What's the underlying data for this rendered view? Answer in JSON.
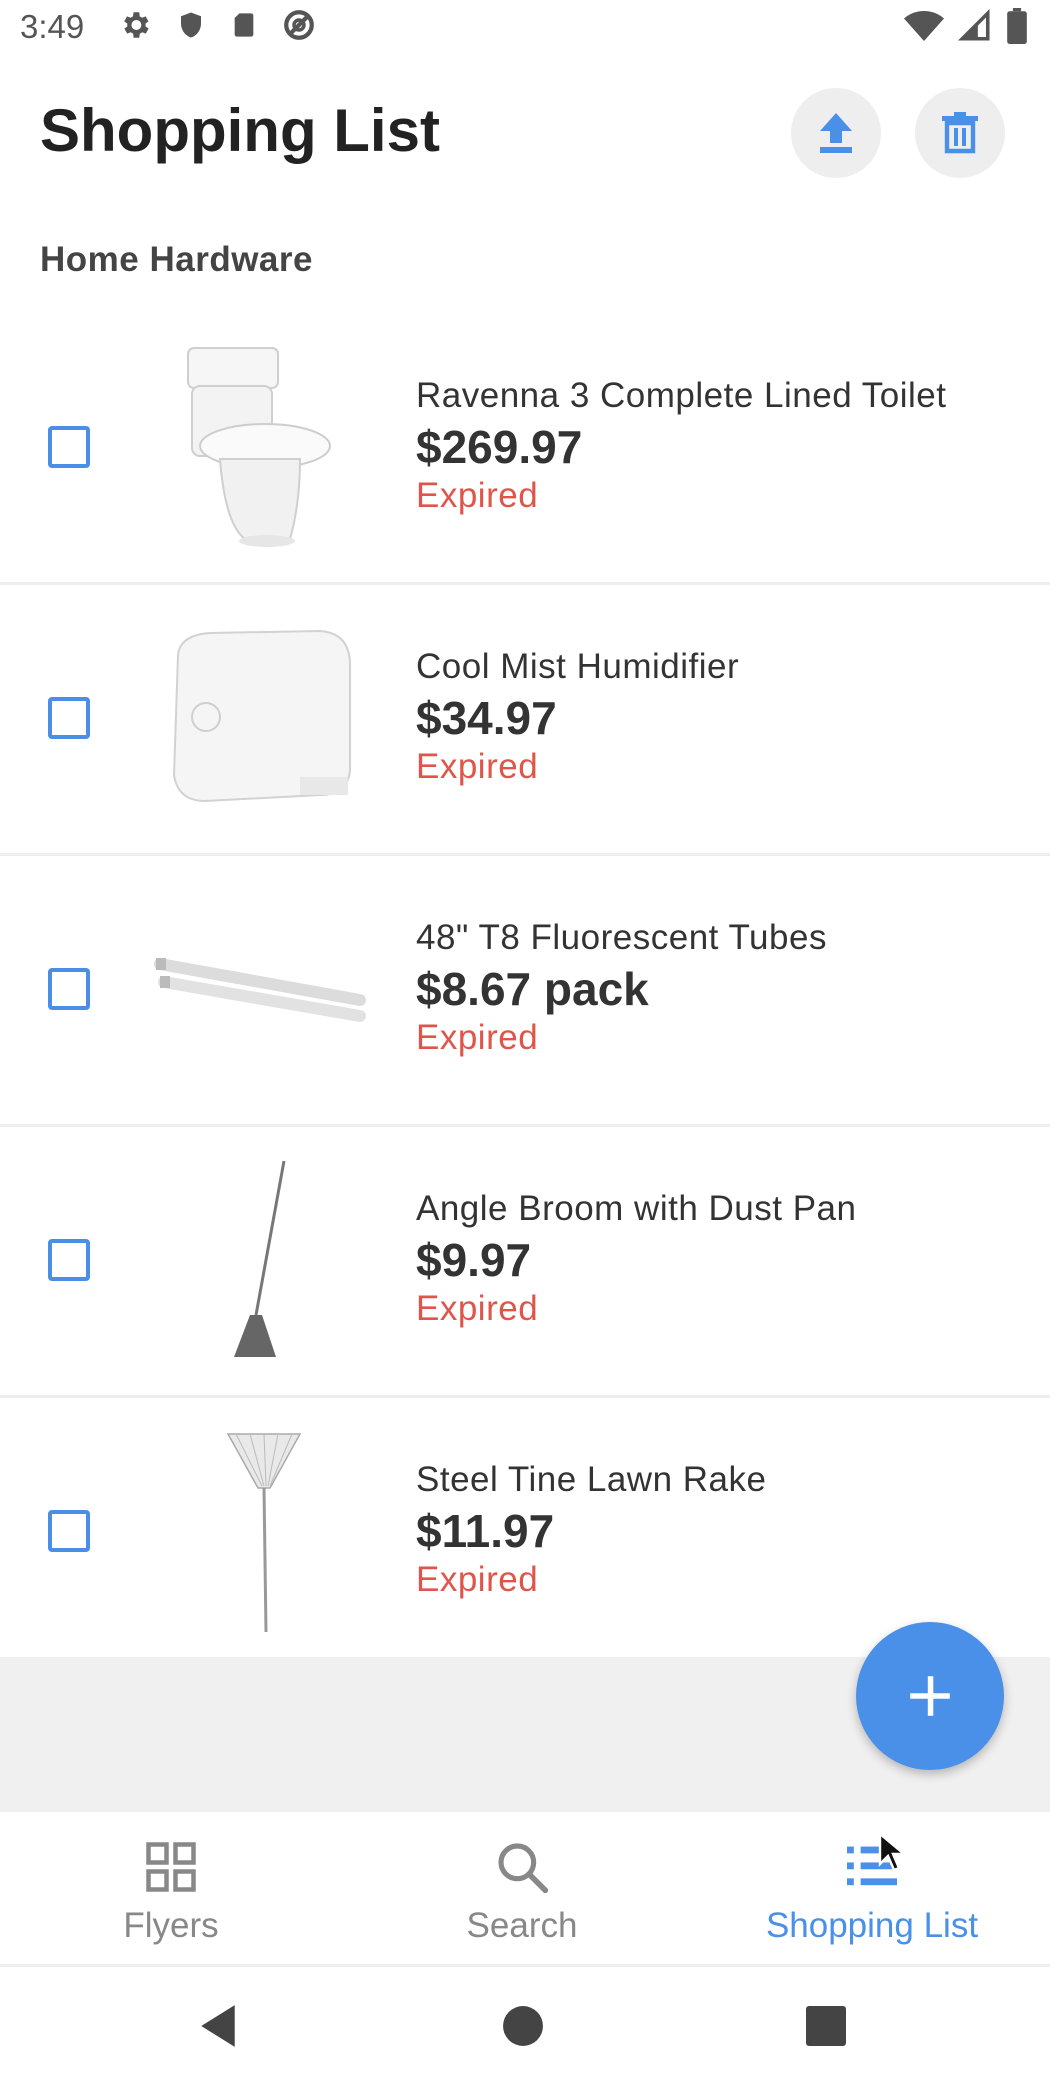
{
  "status_bar": {
    "time": "3:49"
  },
  "header": {
    "title": "Shopping List"
  },
  "section": {
    "title": "Home Hardware"
  },
  "items": [
    {
      "name": "Ravenna 3 Complete Lined Toilet",
      "price": "$269.97",
      "status": "Expired",
      "checked": false
    },
    {
      "name": "Cool Mist Humidifier",
      "price": "$34.97",
      "status": "Expired",
      "checked": false
    },
    {
      "name": "48\" T8 Fluorescent Tubes",
      "price": "$8.67 pack",
      "status": "Expired",
      "checked": false
    },
    {
      "name": "Angle Broom with Dust Pan",
      "price": "$9.97",
      "status": "Expired",
      "checked": false
    },
    {
      "name": "Steel Tine Lawn Rake",
      "price": "$11.97",
      "status": "Expired",
      "checked": false
    }
  ],
  "bottom_nav": {
    "flyers": "Flyers",
    "search": "Search",
    "shopping_list": "Shopping List",
    "active": "shopping_list"
  },
  "colors": {
    "accent": "#4a90e8",
    "expired": "#e0554a",
    "inactive": "#888888"
  }
}
